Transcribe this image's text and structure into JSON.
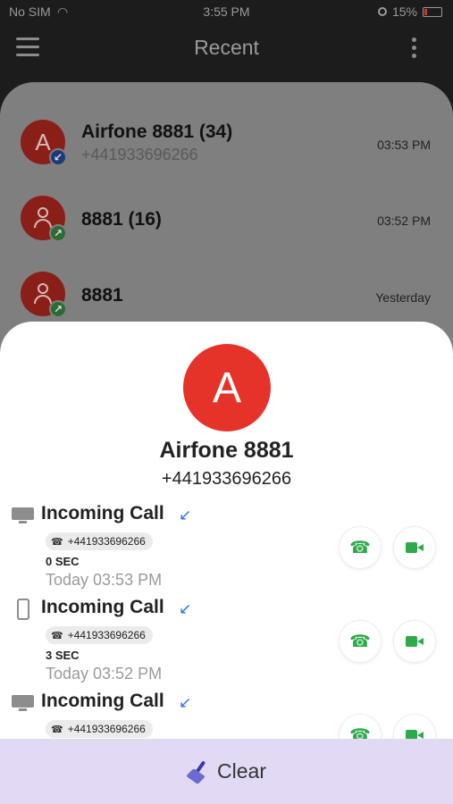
{
  "status_bar": {
    "carrier": "No SIM",
    "time": "3:55 PM",
    "battery": "15%"
  },
  "app_bar": {
    "title": "Recent"
  },
  "recent": [
    {
      "avatar_letter": "A",
      "name": "Airfone 8881 (34)",
      "number": "+441933696266",
      "time": "03:53 PM",
      "direction": "incoming"
    },
    {
      "avatar_letter": "",
      "name": "8881 (16)",
      "number": "",
      "time": "03:52 PM",
      "direction": "outgoing"
    },
    {
      "avatar_letter": "",
      "name": "8881",
      "number": "",
      "time": "Yesterday",
      "direction": "outgoing"
    }
  ],
  "detail": {
    "avatar_letter": "A",
    "name": "Airfone 8881",
    "number": "+441933696266",
    "logs": [
      {
        "device": "desktop",
        "title": "Incoming Call",
        "number": "+441933696266",
        "duration": "0 SEC",
        "time": "Today 03:53 PM"
      },
      {
        "device": "phone",
        "title": "Incoming Call",
        "number": "+441933696266",
        "duration": "3 SEC",
        "time": "Today 03:52 PM"
      },
      {
        "device": "desktop",
        "title": "Incoming Call",
        "number": "+441933696266",
        "duration": "",
        "time": ""
      }
    ]
  },
  "clear_label": "Clear",
  "colors": {
    "accent_red": "#e5332a",
    "call_green": "#2eaa4a",
    "incoming_blue": "#2a6fd6",
    "clear_bar": "#e2daf5"
  }
}
